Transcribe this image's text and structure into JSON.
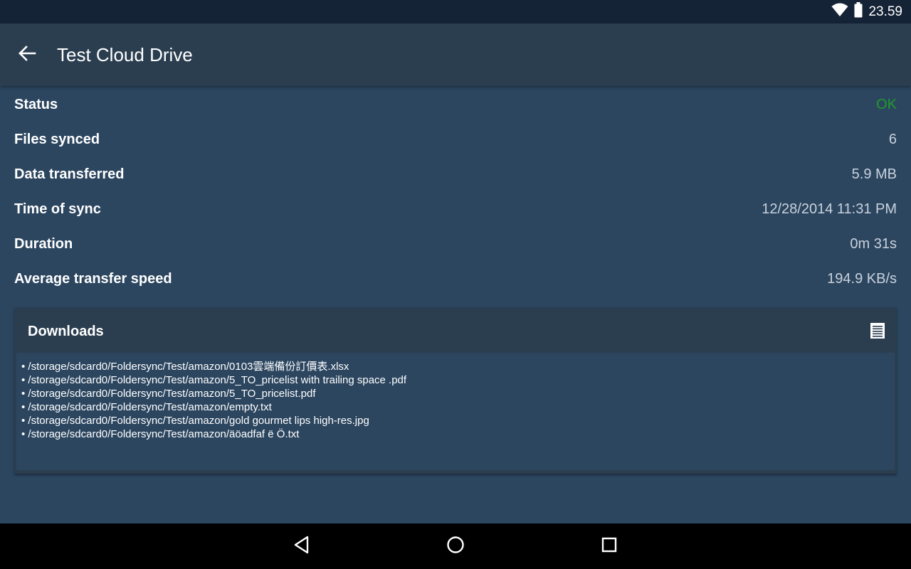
{
  "status_bar": {
    "time": "23.59",
    "icons": [
      "wifi-icon",
      "battery-icon"
    ]
  },
  "toolbar": {
    "back_icon": "arrow-left-icon",
    "title": "Test Cloud Drive"
  },
  "details": {
    "status": {
      "label": "Status",
      "value": "OK"
    },
    "files_synced": {
      "label": "Files synced",
      "value": "6"
    },
    "data_transferred": {
      "label": "Data transferred",
      "value": "5.9 MB"
    },
    "time_of_sync": {
      "label": "Time of sync",
      "value": "12/28/2014 11:31 PM"
    },
    "duration": {
      "label": "Duration",
      "value": "0m 31s"
    },
    "avg_speed": {
      "label": "Average transfer speed",
      "value": "194.9 KB/s"
    }
  },
  "downloads": {
    "title": "Downloads",
    "icon": "document-list-icon",
    "files": [
      "• /storage/sdcard0/Foldersync/Test/amazon/0103雲端備份訂價表.xlsx",
      "• /storage/sdcard0/Foldersync/Test/amazon/5_TO_pricelist with trailing space .pdf",
      "• /storage/sdcard0/Foldersync/Test/amazon/5_TO_pricelist.pdf",
      "• /storage/sdcard0/Foldersync/Test/amazon/empty.txt",
      "• /storage/sdcard0/Foldersync/Test/amazon/gold gourmet lips high-res.jpg",
      "• /storage/sdcard0/Foldersync/Test/amazon/äöadfaf ë Ö.txt"
    ]
  },
  "colors": {
    "background": "#2c4660",
    "toolbar": "#2b3e50",
    "status_ok": "#1f9d2a",
    "value_text": "#c9d2dc"
  },
  "nav_bar": {
    "buttons": [
      "back-triangle-icon",
      "home-circle-icon",
      "recents-square-icon"
    ]
  }
}
